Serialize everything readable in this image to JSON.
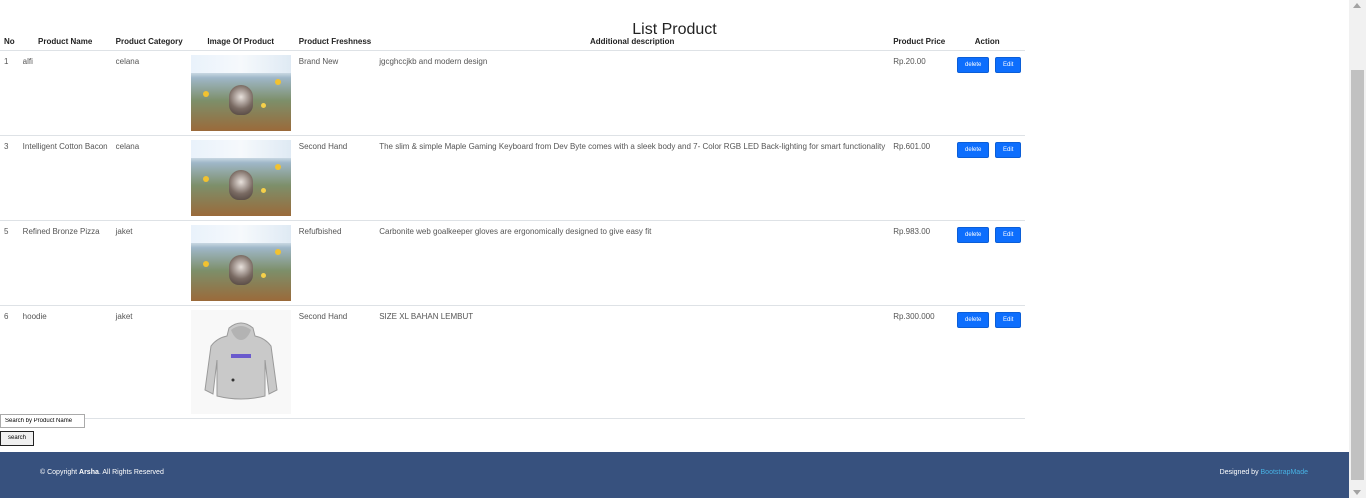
{
  "page": {
    "title": "List Product"
  },
  "table": {
    "headers": {
      "no": "No",
      "name": "Product Name",
      "category": "Product Category",
      "image": "Image Of Product",
      "freshness": "Product Freshness",
      "description": "Additional description",
      "price": "Product Price",
      "action": "Action"
    },
    "rows": [
      {
        "no": "1",
        "name": "alfi",
        "category": "celana",
        "image": "cat-in-flowers-photo",
        "freshness": "Brand New",
        "description": "jgcghccjkb and modern design",
        "price": "Rp.20.00",
        "delete_label": "delete",
        "edit_label": "Edit"
      },
      {
        "no": "3",
        "name": "Intelligent Cotton Bacon",
        "category": "celana",
        "image": "cat-in-flowers-photo",
        "freshness": "Second Hand",
        "description": "The slim & simple Maple Gaming Keyboard from Dev Byte comes with a sleek body and 7- Color RGB LED Back-lighting for smart functionality",
        "price": "Rp.601.00",
        "delete_label": "delete",
        "edit_label": "Edit"
      },
      {
        "no": "5",
        "name": "Refined Bronze Pizza",
        "category": "jaket",
        "image": "cat-in-flowers-photo",
        "freshness": "Refufbished",
        "description": "Carbonite web goalkeeper gloves are ergonomically designed to give easy fit",
        "price": "Rp.983.00",
        "delete_label": "delete",
        "edit_label": "Edit"
      },
      {
        "no": "6",
        "name": "hoodie",
        "category": "jaket",
        "image": "grey-hoodie-photo",
        "freshness": "Second Hand",
        "description": "SIZE XL BAHAN LEMBUT",
        "price": "Rp.300.000",
        "delete_label": "delete",
        "edit_label": "Edit"
      }
    ]
  },
  "search": {
    "placeholder": "Search by Product Name",
    "button_label": "search"
  },
  "footer": {
    "copyright_prefix": "© Copyright ",
    "brand": "Arsha",
    "copyright_suffix": ". All Rights Reserved",
    "designed_by": "Designed by ",
    "designer": "BootstrapMade",
    "link_color": "#47b2e4",
    "background": "#37517e"
  }
}
